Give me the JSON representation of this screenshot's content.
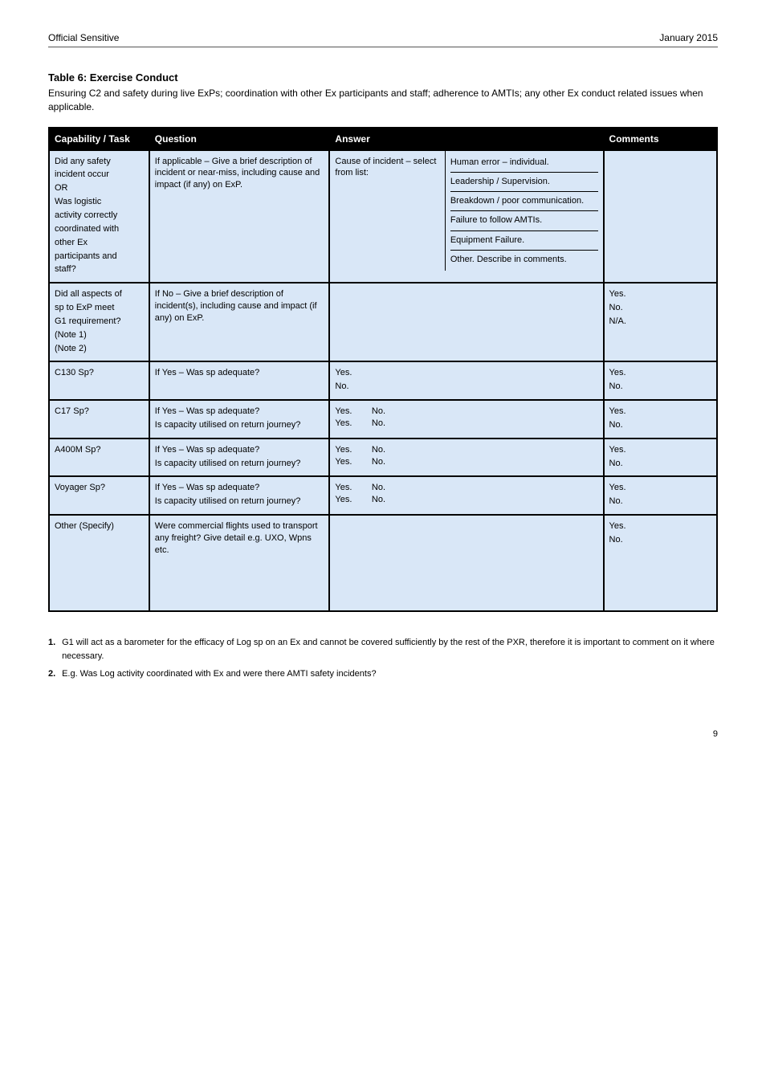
{
  "header": {
    "left": "Official Sensitive",
    "right": "January 2015"
  },
  "table_title": "Table 6:           Exercise Conduct",
  "table_subtitle": "Ensuring C2 and safety during live ExPs; coordination with other Ex participants and staff; adherence to AMTIs; any other Ex conduct related issues when applicable.",
  "columns": [
    "Capability / Task",
    "Question",
    "Answer",
    "Comments"
  ],
  "rows": [
    {
      "cap": [
        "Did any safety",
        "incident occur",
        "OR",
        "Was logistic",
        "activity correctly",
        "coordinated with",
        "other Ex",
        "participants and",
        "staff?"
      ],
      "question": "If applicable – Give a brief description of incident or near-miss, including cause and impact (if any) on ExP.",
      "answer_split": {
        "left": "Cause of incident – select from list:",
        "right_rows": [
          "Human error – individual.",
          "Leadership / Supervision.",
          "Breakdown / poor communication.",
          "Failure to follow AMTIs.",
          "Equipment Failure.",
          "Other. Describe in comments."
        ]
      },
      "comments": ""
    },
    {
      "cap": [
        "Did all aspects of",
        "sp to ExP meet",
        "G1 requirement?",
        "(Note 1)",
        "(Note 2)"
      ],
      "question": "If No – Give a brief description of incident(s), including cause and impact (if any) on ExP.",
      "answer": "",
      "comments": [
        "Yes.",
        "No.",
        "N/A."
      ]
    },
    {
      "cap": [
        "C130 Sp?"
      ],
      "question": "If Yes – Was sp adequate?",
      "answer": [
        "Yes.",
        "No."
      ],
      "comments": [
        "Yes.",
        "No."
      ]
    },
    {
      "cap": [
        "C17 Sp?"
      ],
      "question": [
        "If Yes – Was sp adequate?",
        "Is capacity utilised on return journey?"
      ],
      "answer": [
        "Yes.",
        "No.",
        "Yes.",
        "No."
      ],
      "comments": [
        "Yes.",
        "No."
      ]
    },
    {
      "cap": [
        "A400M Sp?"
      ],
      "question": [
        "If Yes – Was sp adequate?",
        "Is capacity utilised on return journey?"
      ],
      "answer": [
        "Yes.",
        "No.",
        "Yes.",
        "No."
      ],
      "comments": [
        "Yes.",
        "No."
      ]
    },
    {
      "cap": [
        "Voyager Sp?"
      ],
      "question": [
        "If Yes – Was sp adequate?",
        "Is capacity utilised on return journey?"
      ],
      "answer": [
        "Yes.",
        "No.",
        "Yes.",
        "No."
      ],
      "comments": [
        "Yes.",
        "No."
      ]
    },
    {
      "cap": [
        "Other (Specify)"
      ],
      "question": "Were commercial flights used to transport any freight? Give detail e.g. UXO, Wpns etc.",
      "answer": "",
      "comments": [
        "Yes.",
        "No."
      ]
    }
  ],
  "footnotes": [
    {
      "lbl": "1.",
      "txt": "G1 will act as a barometer for the efficacy of Log sp on an Ex and cannot be covered sufficiently by the rest of the PXR, therefore it is important to comment on it where necessary."
    },
    {
      "lbl": "2.",
      "txt": "E.g. Was Log activity coordinated with Ex and were there AMTI safety incidents?"
    }
  ],
  "page_number": "9"
}
